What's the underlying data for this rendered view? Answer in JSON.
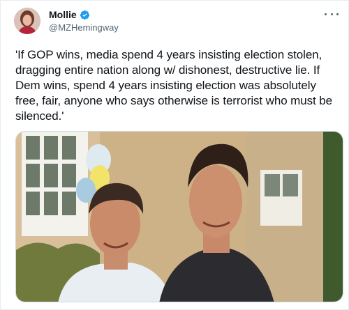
{
  "author": {
    "display_name": "Mollie",
    "handle": "@MZHemingway",
    "verified": true,
    "avatar_icon": "profile-photo"
  },
  "tweet": {
    "text": "'If GOP wins, media spend 4 years insisting election stolen, dragging entire nation along w/ dishonest, destructive lie. If Dem wins, spend 4 years insisting election was absolutely free, fair, anyone who says otherwise is terrorist who must be silenced.'"
  },
  "media": {
    "kind": "photo",
    "description_icon": "photo-two-men-outdoors"
  },
  "icons": {
    "more": "more-options-icon",
    "verified": "verified-badge-icon"
  },
  "colors": {
    "verified_blue": "#1d9bf0",
    "text": "#0f1419",
    "secondary": "#536471",
    "border": "#cfd9de"
  }
}
